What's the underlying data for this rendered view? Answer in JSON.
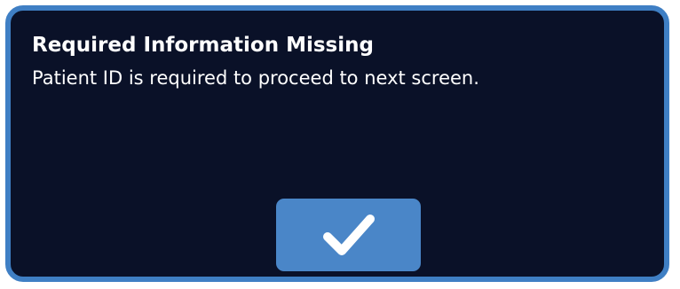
{
  "dialog": {
    "title": "Required Information Missing",
    "message": "Patient ID is required to proceed to next screen.",
    "confirm_button": {
      "icon": "checkmark-icon"
    }
  },
  "colors": {
    "background": "#0a1128",
    "border": "#3f7fc4",
    "button": "#4a86c8",
    "text": "#ffffff"
  }
}
